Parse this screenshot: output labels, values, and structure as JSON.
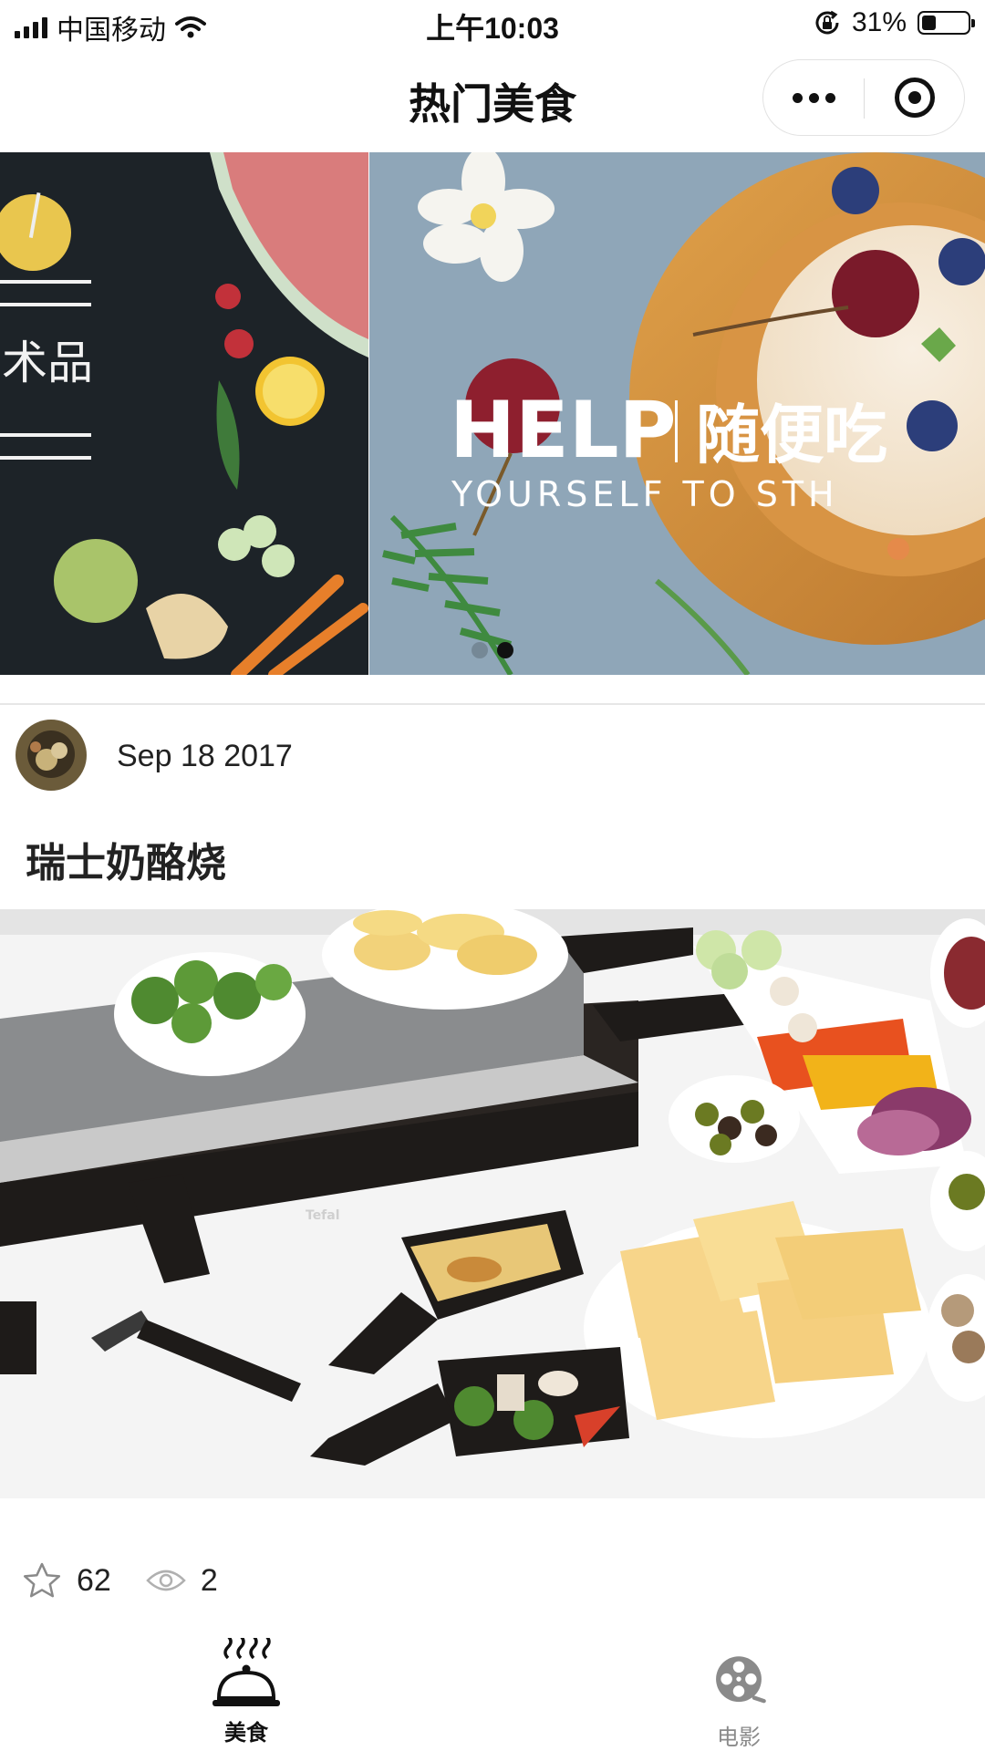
{
  "status_bar": {
    "carrier": "中国移动",
    "time": "上午10:03",
    "battery_percent": "31%",
    "battery_level": 0.31
  },
  "nav": {
    "title": "热门美食"
  },
  "banner": {
    "text_left_fragment": "术品",
    "headline_en": "HELP",
    "headline_cn": "随便吃",
    "subline": "YOURSELF TO STH",
    "slide_count": 2,
    "active_slide": 2
  },
  "post": {
    "date": "Sep 18 2017",
    "title": "瑞士奶酪烧",
    "photo_brand": "Tefal",
    "stars": "62",
    "views": "2"
  },
  "tab_bar": {
    "items": [
      {
        "label": "美食",
        "icon": "cloche-icon",
        "active": true
      },
      {
        "label": "电影",
        "icon": "film-reel-icon",
        "active": false
      }
    ]
  },
  "colors": {
    "text": "#222222",
    "tab_active": "#111111",
    "tab_inactive": "#8a8a8a",
    "banner_blue": "#8fa6b8",
    "banner_dark": "#1d2328"
  }
}
